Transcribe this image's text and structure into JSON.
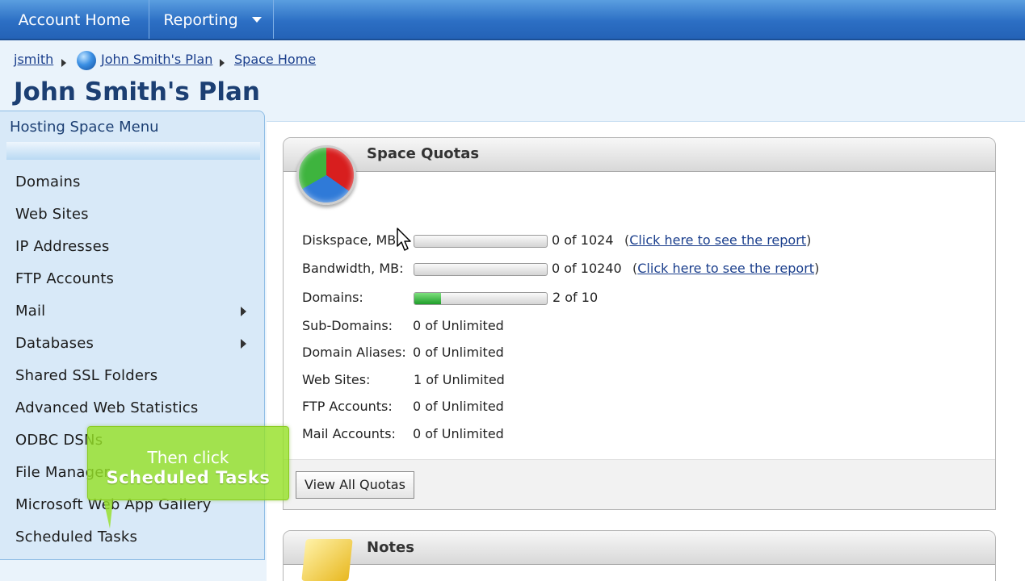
{
  "nav": {
    "home": "Account Home",
    "reporting": "Reporting"
  },
  "breadcrumb": {
    "user": "jsmith",
    "plan": "John Smith's Plan",
    "space": "Space Home"
  },
  "page_title": "John Smith's Plan",
  "menu": {
    "title": "Hosting Space Menu",
    "items": [
      "Domains",
      "Web Sites",
      "IP Addresses",
      "FTP Accounts",
      "Mail",
      "Databases",
      "Shared SSL Folders",
      "Advanced Web Statistics",
      "ODBC DSNs",
      "File Manager",
      "Microsoft Web App Gallery",
      "Scheduled Tasks"
    ]
  },
  "callout": {
    "line1": "Then click",
    "line2": "Scheduled Tasks"
  },
  "quotas": {
    "title": "Space Quotas",
    "rows": [
      {
        "label": "Diskspace, MB:",
        "value": "0 of 1024",
        "used": 0,
        "total": 1024,
        "link_open": "(",
        "link": "Click here to see the report",
        "link_close": ")"
      },
      {
        "label": "Bandwidth, MB:",
        "value": "0 of 10240",
        "used": 0,
        "total": 10240,
        "link_open": "(",
        "link": "Click here to see the report",
        "link_close": ")"
      },
      {
        "label": "Domains:",
        "value": "2 of 10",
        "used": 2,
        "total": 10
      },
      {
        "label": "Sub-Domains:",
        "value": "0 of Unlimited"
      },
      {
        "label": "Domain Aliases:",
        "value": "0 of Unlimited"
      },
      {
        "label": "Web Sites:",
        "value": "1 of Unlimited"
      },
      {
        "label": "FTP Accounts:",
        "value": "0 of Unlimited"
      },
      {
        "label": "Mail Accounts:",
        "value": "0 of Unlimited"
      }
    ],
    "button": "View All Quotas"
  },
  "notes": {
    "title": "Notes"
  },
  "colors": {
    "nav_blue": "#2c6fc4",
    "link": "#1a3e8c",
    "callout_green": "#96e128",
    "progress_green": "#1f9e2a"
  },
  "icons": {
    "globe": "globe-icon",
    "pie_chart": "pie-chart-icon",
    "folder": "folder-icon",
    "cursor": "cursor-icon",
    "dropdown": "chevron-down-icon",
    "submenu": "arrow-right-icon"
  }
}
